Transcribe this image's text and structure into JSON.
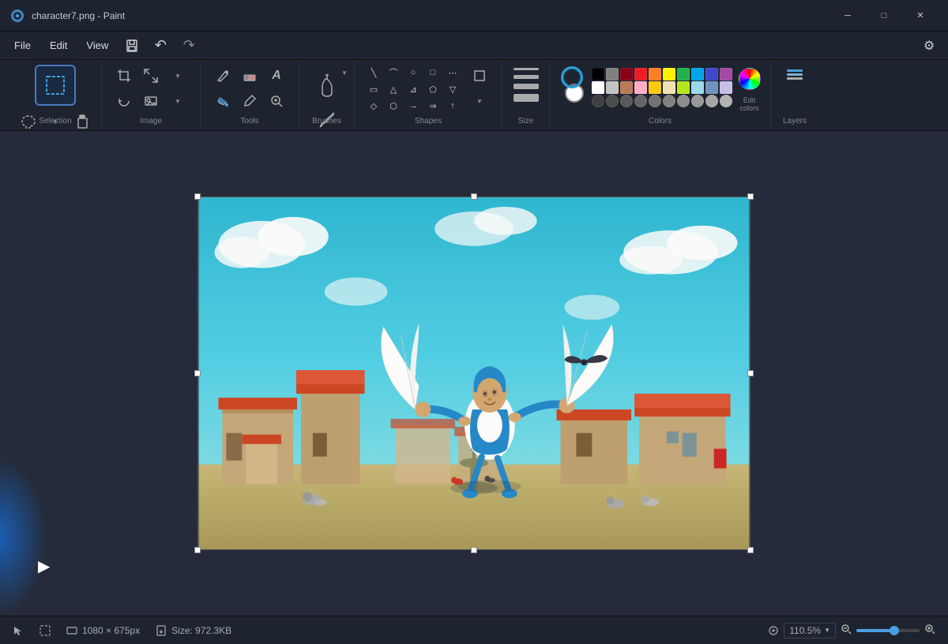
{
  "app": {
    "title": "character7.png - Paint",
    "icon": "🎨"
  },
  "titlebar": {
    "minimize_label": "─",
    "maximize_label": "□",
    "close_label": "✕",
    "settings_label": "⚙"
  },
  "menubar": {
    "file": "File",
    "edit": "Edit",
    "view": "View",
    "undo_icon": "↶",
    "redo_icon": "↷",
    "save_icon": "💾"
  },
  "toolbar": {
    "groups": {
      "selection": {
        "label": "Selection"
      },
      "image": {
        "label": "Image"
      },
      "tools": {
        "label": "Tools"
      },
      "brushes": {
        "label": "Brushes"
      },
      "shapes": {
        "label": "Shapes"
      },
      "size": {
        "label": "Size"
      },
      "colors": {
        "label": "Colors"
      },
      "layers": {
        "label": "Layers"
      }
    }
  },
  "colors": {
    "row1": [
      "#000000",
      "#7f7f7f",
      "#880015",
      "#ed1c24",
      "#ff7f27",
      "#fff200",
      "#22b14c",
      "#00a2e8",
      "#3f48cc",
      "#a349a4"
    ],
    "row2": [
      "#ffffff",
      "#c3c3c3",
      "#b97a57",
      "#ffaec9",
      "#ffc90e",
      "#efe4b0",
      "#b5e61d",
      "#99d9ea",
      "#7092be",
      "#c8bfe7"
    ],
    "row3": [
      "#404040",
      "#808080",
      "#404040",
      "#808080",
      "#404040",
      "#808080",
      "#404040",
      "#808080",
      "#404040",
      "#808080"
    ]
  },
  "statusbar": {
    "dimensions": "1080 × 675px",
    "size": "Size: 972.3KB",
    "zoom": "110.5%"
  },
  "canvas": {
    "selection_active": true
  }
}
